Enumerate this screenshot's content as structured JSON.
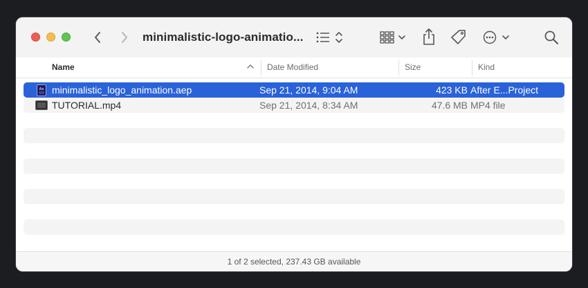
{
  "window": {
    "title": "minimalistic-logo-animatio...",
    "status_text": "1 of 2 selected, 237.43 GB available"
  },
  "toolbar": {
    "back_icon": "chevron-left-icon",
    "forward_icon": "chevron-right-icon",
    "list_view_icon": "list-view-icon",
    "grid_view_icon": "grid-view-icon",
    "share_icon": "share-icon",
    "tag_icon": "tag-icon",
    "more_icon": "ellipsis-circle-icon",
    "search_icon": "search-icon"
  },
  "columns": {
    "name": "Name",
    "date_modified": "Date Modified",
    "size": "Size",
    "kind": "Kind",
    "sort_indicator": "^"
  },
  "files": [
    {
      "name": "minimalistic_logo_animation.aep",
      "date_modified": "Sep 21, 2014, 9:04 AM",
      "size": "423 KB",
      "kind": "After E...Project",
      "icon": "after-effects-file-icon",
      "selected": true
    },
    {
      "name": "TUTORIAL.mp4",
      "date_modified": "Sep 21, 2014, 8:34 AM",
      "size": "47.6 MB",
      "kind": "MP4 file",
      "icon": "video-file-icon",
      "selected": false
    }
  ],
  "colors": {
    "selection": "#2a62d9",
    "close": "#ee5f57",
    "minimize": "#f4bd4f",
    "zoom": "#61c454"
  }
}
